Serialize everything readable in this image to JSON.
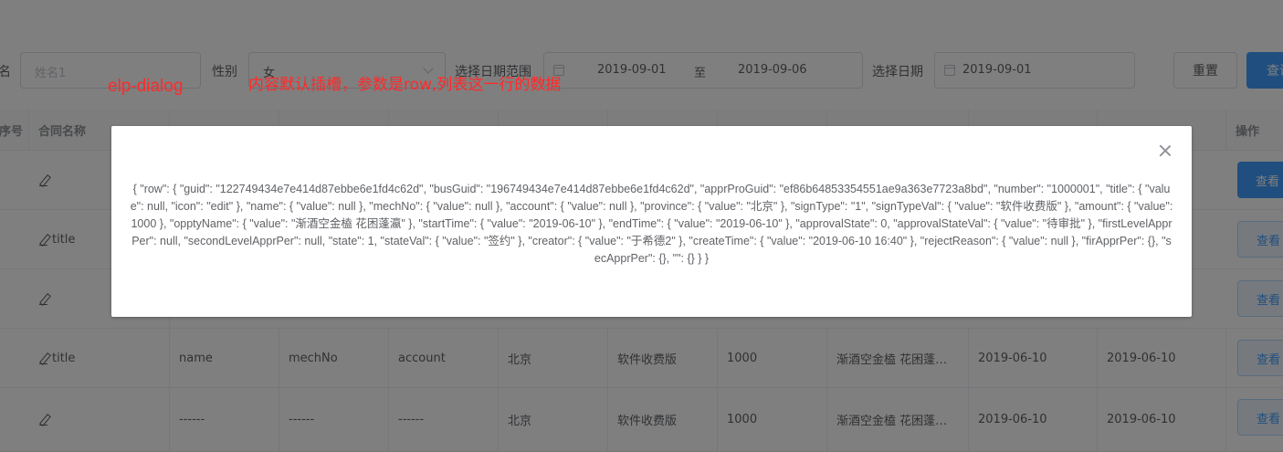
{
  "filter": {
    "name_label": "名",
    "name_placeholder": "姓名1",
    "gender_label": "性别",
    "gender_value": "女",
    "range_label": "选择日期范围",
    "range_start": "2019-09-01",
    "range_sep": "至",
    "range_end": "2019-09-06",
    "date_label": "选择日期",
    "date_value": "2019-09-01",
    "reset_label": "重置",
    "query_label": "查询"
  },
  "annotations": {
    "component": "elp-dialog",
    "note": "内容默认插槽，参数是row,列表这一行的数据"
  },
  "table": {
    "headers": [
      "序号",
      "合同名称",
      "",
      "",
      "",
      "",
      "",
      "",
      "",
      "",
      "",
      "操作"
    ],
    "rows": [
      {
        "title": "",
        "name": "",
        "mechNo": "",
        "account": "",
        "province": "",
        "signType": "",
        "amount": "",
        "opptyName": "",
        "startTime": "",
        "endTime": "",
        "action": "查看"
      },
      {
        "title": "title",
        "name": "",
        "mechNo": "",
        "account": "",
        "province": "",
        "signType": "",
        "amount": "",
        "opptyName": "",
        "startTime": "",
        "endTime": "",
        "action": "查看"
      },
      {
        "title": "",
        "name": "",
        "mechNo": "",
        "account": "",
        "province": "",
        "signType": "",
        "amount": "",
        "opptyName": "",
        "startTime": "",
        "endTime": "",
        "action": "查看"
      },
      {
        "title": "title",
        "name": "name",
        "mechNo": "mechNo",
        "account": "account",
        "province": "北京",
        "signType": "软件收费版",
        "amount": "1000",
        "opptyName": "渐酒空金榼 花困蓬…",
        "startTime": "2019-06-10",
        "endTime": "2019-06-10",
        "action": "查看"
      },
      {
        "title": "",
        "name": "------",
        "mechNo": "------",
        "account": "------",
        "province": "北京",
        "signType": "软件收费版",
        "amount": "1000",
        "opptyName": "渐酒空金榼 花困蓬…",
        "startTime": "2019-06-10",
        "endTime": "2019-06-10",
        "action": "查看"
      }
    ]
  },
  "dialog": {
    "content": "{ \"row\": { \"guid\": \"122749434e7e414d87ebbe6e1fd4c62d\", \"busGuid\": \"196749434e7e414d87ebbe6e1fd4c62d\", \"apprProGuid\": \"ef86b64853354551ae9a363e7723a8bd\", \"number\": \"1000001\", \"title\": { \"value\": null, \"icon\": \"edit\" }, \"name\": { \"value\": null }, \"mechNo\": { \"value\": null }, \"account\": { \"value\": null }, \"province\": { \"value\": \"北京\" }, \"signType\": \"1\", \"signTypeVal\": { \"value\": \"软件收费版\" }, \"amount\": { \"value\": 1000 }, \"opptyName\": { \"value\": \"渐酒空金榼 花困蓬瀛\" }, \"startTime\": { \"value\": \"2019-06-10\" }, \"endTime\": { \"value\": \"2019-06-10\" }, \"approvalState\": 0, \"approvalStateVal\": { \"value\": \"待审批\" }, \"firstLevelApprPer\": null, \"secondLevelApprPer\": null, \"state\": 1, \"stateVal\": { \"value\": \"签约\" }, \"creator\": { \"value\": \"于希德2\" }, \"createTime\": { \"value\": \"2019-06-10 16:40\" }, \"rejectReason\": { \"value\": null }, \"firApprPer\": {}, \"secApprPer\": {}, \"\": {} } }"
  }
}
